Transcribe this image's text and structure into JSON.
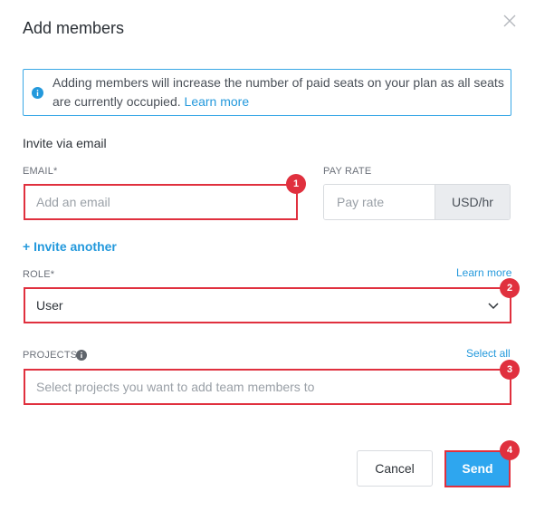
{
  "dialog": {
    "title": "Add members"
  },
  "notice": {
    "text": "Adding members will increase the number of paid seats on your plan as all seats are currently occupied.",
    "link": "Learn more"
  },
  "invite_section": {
    "title": "Invite via email"
  },
  "email": {
    "label": "EMAIL*",
    "placeholder": "Add an email"
  },
  "pay_rate": {
    "label": "PAY RATE",
    "placeholder": "Pay rate",
    "unit": "USD/hr"
  },
  "invite_another": "+ Invite another",
  "role": {
    "label": "ROLE*",
    "learn_more": "Learn more",
    "value": "User"
  },
  "projects": {
    "label": "PROJECTS",
    "select_all": "Select all",
    "placeholder": "Select projects you want to add team members to"
  },
  "footer": {
    "cancel_label": "Cancel",
    "send_label": "Send"
  },
  "markers": [
    "1",
    "2",
    "3",
    "4"
  ],
  "colors": {
    "accent": "#2499dc",
    "primary_button": "#2ea6ef",
    "highlight": "#e0303e",
    "notice_border": "#3aa8e6"
  },
  "icons": [
    "close-icon",
    "info-icon",
    "chevron-down-icon",
    "info-icon"
  ]
}
